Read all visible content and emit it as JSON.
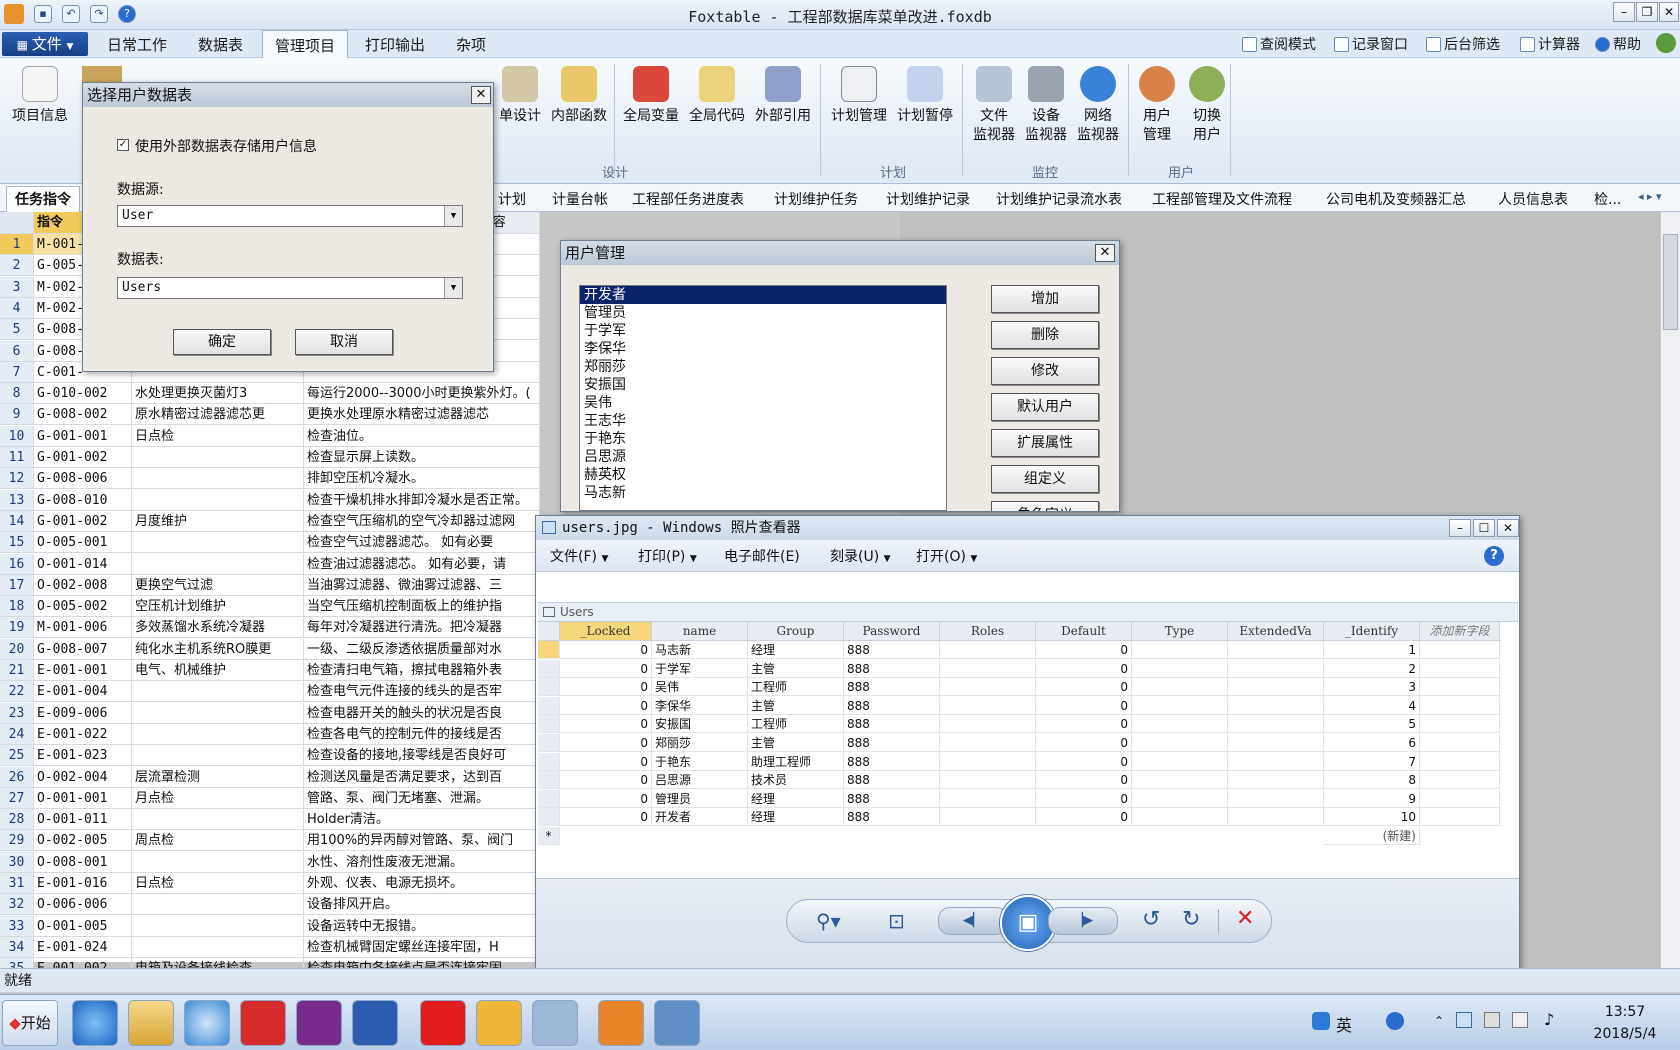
{
  "window": {
    "title": "Foxtable - 工程部数据库菜单改进.foxdb"
  },
  "menu": {
    "file": "文件",
    "tabs": [
      "日常工作",
      "数据表",
      "管理项目",
      "打印输出",
      "杂项"
    ],
    "tools": [
      "查阅模式",
      "记录窗口",
      "后台筛选",
      "计算器",
      "帮助"
    ]
  },
  "ribbon": {
    "buttons": {
      "project_info": "项目信息",
      "form_design": "单设计",
      "inner_func": "内部函数",
      "global_var": "全局变量",
      "global_code": "全局代码",
      "ext_ref": "外部引用",
      "plan_manage": "计划管理",
      "plan_pause": "计划暂停",
      "file_monitor_1": "文件",
      "file_monitor_2": "监视器",
      "device_monitor_1": "设备",
      "device_monitor_2": "监视器",
      "net_monitor_1": "网络",
      "net_monitor_2": "监视器",
      "user_manage_1": "用户",
      "user_manage_2": "管理",
      "switch_user_1": "切换",
      "switch_user_2": "用户"
    },
    "groups": {
      "design": "设计",
      "plan": "计划",
      "monitor": "监控",
      "user": "用户"
    }
  },
  "table_tabs": [
    "任务指令",
    "计划",
    "计量台帐",
    "工程部任务进度表",
    "计划维护任务",
    "计划维护记录",
    "计划维护记录流水表",
    "工程部管理及文件流程",
    "公司电机及变频器汇总",
    "人员信息表",
    "检..."
  ],
  "grid": {
    "headers": [
      "指令",
      "",
      "SINOMED计划任务指令内容"
    ],
    "rows": [
      {
        "n": "1",
        "code": "M-001-",
        "name": "",
        "content": ""
      },
      {
        "n": "2",
        "code": "G-005-",
        "name": "",
        "content": ""
      },
      {
        "n": "3",
        "code": "M-002-",
        "name": "",
        "content": ""
      },
      {
        "n": "4",
        "code": "M-002-",
        "name": "",
        "content": ""
      },
      {
        "n": "5",
        "code": "G-008-",
        "name": "",
        "content": ""
      },
      {
        "n": "6",
        "code": "G-008-",
        "name": "",
        "content": ""
      },
      {
        "n": "7",
        "code": "C-001-",
        "name": "",
        "content": ""
      },
      {
        "n": "8",
        "code": "G-010-002",
        "name": "水处理更换灭菌灯3",
        "content": "每运行2000--3000小时更换紫外灯。("
      },
      {
        "n": "9",
        "code": "G-008-002",
        "name": "原水精密过滤器滤芯更",
        "content": "更换水处理原水精密过滤器滤芯"
      },
      {
        "n": "10",
        "code": "G-001-001",
        "name": "日点检",
        "content": "检查油位。"
      },
      {
        "n": "11",
        "code": "G-001-002",
        "name": "",
        "content": "检查显示屏上读数。"
      },
      {
        "n": "12",
        "code": "G-008-006",
        "name": "",
        "content": "排卸空压机冷凝水。"
      },
      {
        "n": "13",
        "code": "G-008-010",
        "name": "",
        "content": "检查干燥机排水排卸冷凝水是否正常。"
      },
      {
        "n": "14",
        "code": "G-001-002",
        "name": "月度维护",
        "content": "检查空气压缩机的空气冷却器过滤网"
      },
      {
        "n": "15",
        "code": "O-005-001",
        "name": "",
        "content": "检查空气过滤器滤芯。  如有必要"
      },
      {
        "n": "16",
        "code": "O-001-014",
        "name": "",
        "content": "检查油过滤器滤芯。 如有必要，请"
      },
      {
        "n": "17",
        "code": "O-002-008",
        "name": "更换空气过滤",
        "content": "当油雾过滤器、微油雾过滤器、三"
      },
      {
        "n": "18",
        "code": "O-005-002",
        "name": "空压机计划维护",
        "content": "当空气压缩机控制面板上的维护指"
      },
      {
        "n": "19",
        "code": "M-001-006",
        "name": "多效蒸馏水系统冷凝器",
        "content": "每年对冷凝器进行清洗。把冷凝器"
      },
      {
        "n": "20",
        "code": "G-008-007",
        "name": "纯化水主机系统RO膜更",
        "content": "一级、二级反渗透依据质量部对水"
      },
      {
        "n": "21",
        "code": "E-001-001",
        "name": "电气、机械维护",
        "content": "检查清扫电气箱，擦拭电器箱外表"
      },
      {
        "n": "22",
        "code": "E-001-004",
        "name": "",
        "content": "检查电气元件连接的线头的是否牢"
      },
      {
        "n": "23",
        "code": "E-009-006",
        "name": "",
        "content": "检查电器开关的触头的状况是否良"
      },
      {
        "n": "24",
        "code": "E-001-022",
        "name": "",
        "content": "检查各电气的控制元件的接线是否"
      },
      {
        "n": "25",
        "code": "E-001-023",
        "name": "",
        "content": "检查设备的接地,接零线是否良好可"
      },
      {
        "n": "26",
        "code": "O-002-004",
        "name": "层流罩检测",
        "content": "检测送风量是否满足要求，达到百"
      },
      {
        "n": "27",
        "code": "O-001-001",
        "name": "月点检",
        "content": "管路、泵、阀门无堵塞、泄漏。"
      },
      {
        "n": "28",
        "code": "O-001-011",
        "name": "",
        "content": "Holder清洁。"
      },
      {
        "n": "29",
        "code": "O-002-005",
        "name": "周点检",
        "content": "用100%的异丙醇对管路、泵、阀门"
      },
      {
        "n": "30",
        "code": "O-008-001",
        "name": "",
        "content": "水性、溶剂性废液无泄漏。"
      },
      {
        "n": "31",
        "code": "E-001-016",
        "name": "日点检",
        "content": "外观、仪表、电源无损坏。"
      },
      {
        "n": "32",
        "code": "O-006-006",
        "name": "",
        "content": "设备排风开启。"
      },
      {
        "n": "33",
        "code": "O-001-005",
        "name": "",
        "content": "设备运转中无报错。"
      },
      {
        "n": "34",
        "code": "E-001-024",
        "name": "",
        "content": "检查机械臂固定螺丝连接牢固，H"
      },
      {
        "n": "35",
        "code": "E-001-002",
        "name": "电箱及设备接线检查",
        "content": "检查电箱中各接线点是否连接牢固"
      }
    ]
  },
  "select_dialog": {
    "title": "选择用户数据表",
    "checkbox_label": "使用外部数据表存储用户信息",
    "source_label": "数据源:",
    "source_value": "User",
    "table_label": "数据表:",
    "table_value": "Users",
    "ok": "确定",
    "cancel": "取消"
  },
  "user_dialog": {
    "title": "用户管理",
    "users": [
      "开发者",
      "管理员",
      "于学军",
      "李保华",
      "郑丽莎",
      "安振国",
      "吴伟",
      "王志华",
      "于艳东",
      "吕思源",
      "赫英权",
      "马志新"
    ],
    "buttons": [
      "增加",
      "删除",
      "修改",
      "默认用户",
      "扩展属性",
      "组定义",
      "角色定义"
    ]
  },
  "viewer": {
    "title": "users.jpg - Windows 照片查看器",
    "menu": [
      "文件(F)",
      "打印(P)",
      "电子邮件(E)",
      "刻录(U)",
      "打开(O)"
    ],
    "table_name": "Users",
    "headers": [
      "_Locked",
      "name",
      "Group",
      "Password",
      "Roles",
      "Default",
      "Type",
      "ExtendedVa",
      "_Identify",
      "添加新字段"
    ],
    "rows": [
      {
        "locked": "0",
        "name": "马志新",
        "group": "经理",
        "password": "888",
        "def": "0",
        "id": "1"
      },
      {
        "locked": "0",
        "name": "于学军",
        "group": "主管",
        "password": "888",
        "def": "0",
        "id": "2"
      },
      {
        "locked": "0",
        "name": "吴伟",
        "group": "工程师",
        "password": "888",
        "def": "0",
        "id": "3"
      },
      {
        "locked": "0",
        "name": "李保华",
        "group": "主管",
        "password": "888",
        "def": "0",
        "id": "4"
      },
      {
        "locked": "0",
        "name": "安振国",
        "group": "工程师",
        "password": "888",
        "def": "0",
        "id": "5"
      },
      {
        "locked": "0",
        "name": "郑丽莎",
        "group": "主管",
        "password": "888",
        "def": "0",
        "id": "6"
      },
      {
        "locked": "0",
        "name": "于艳东",
        "group": "助理工程师",
        "password": "888",
        "def": "0",
        "id": "7"
      },
      {
        "locked": "0",
        "name": "吕思源",
        "group": "技术员",
        "password": "888",
        "def": "0",
        "id": "8"
      },
      {
        "locked": "0",
        "name": "管理员",
        "group": "经理",
        "password": "888",
        "def": "0",
        "id": "9"
      },
      {
        "locked": "0",
        "name": "开发者",
        "group": "经理",
        "password": "888",
        "def": "0",
        "id": "10"
      }
    ],
    "new_row_marker": "*",
    "new_row_label": "(新建)"
  },
  "status": {
    "text": "就绪"
  },
  "taskbar": {
    "start": "开始",
    "time": "13:57",
    "date": "2018/5/4",
    "ime": "英"
  }
}
